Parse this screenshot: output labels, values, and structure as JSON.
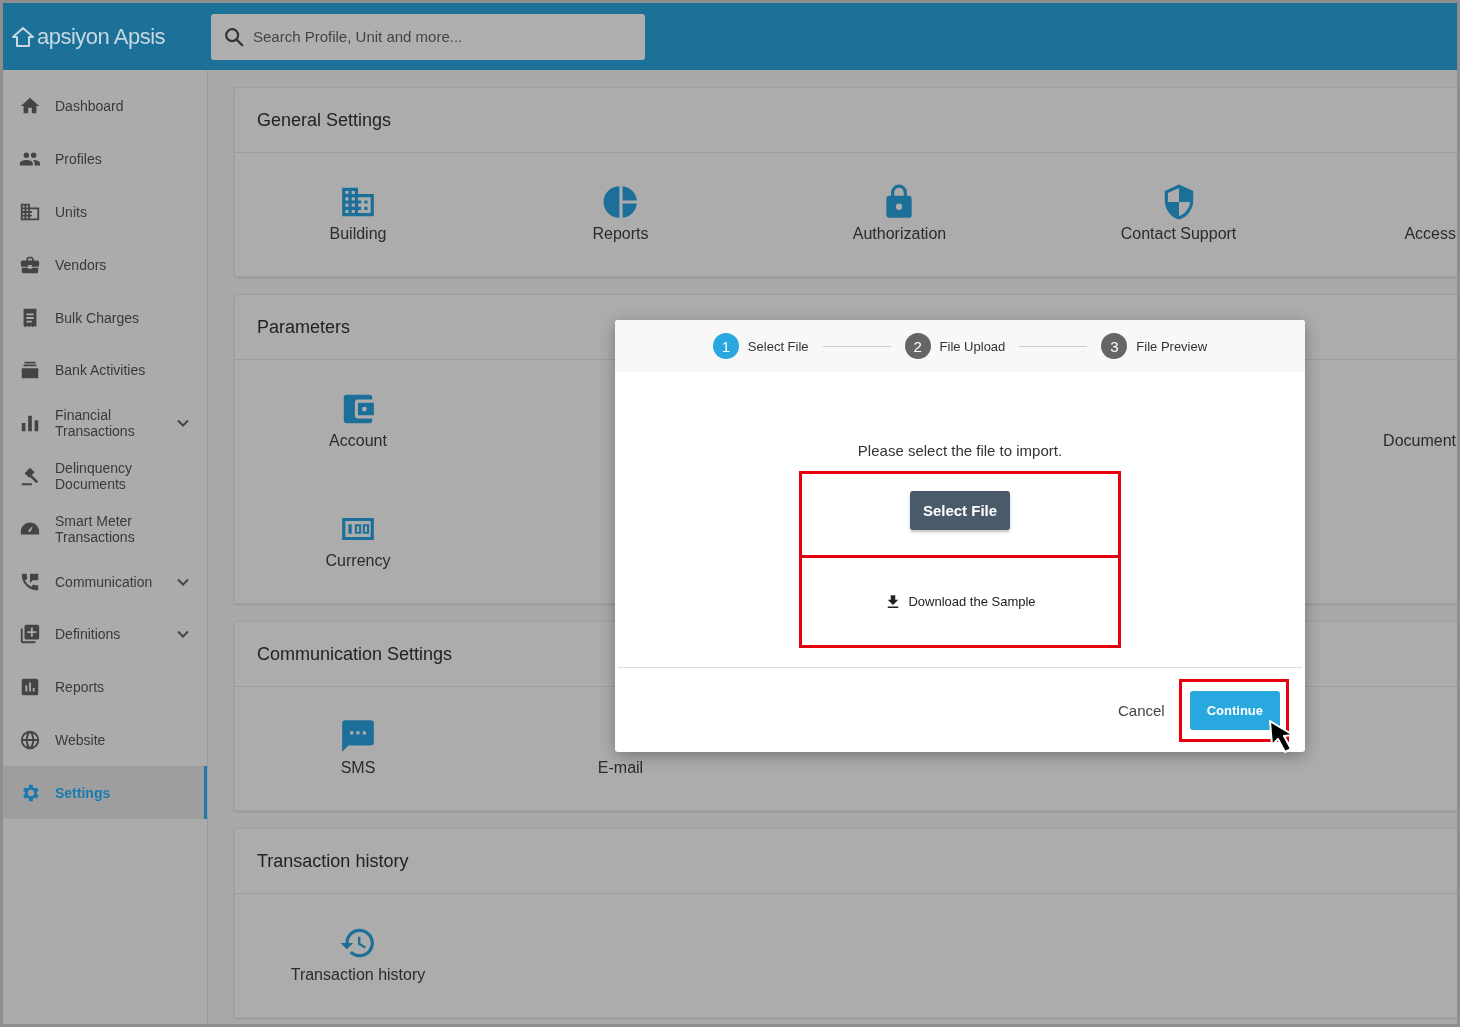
{
  "header": {
    "logo": "apsiyon Apsis",
    "search": {
      "placeholder": "Search Profile, Unit and more..."
    }
  },
  "sidebar": {
    "items": [
      {
        "label": "Dashboard",
        "selected": false,
        "has_submenu": false
      },
      {
        "label": "Profiles",
        "selected": false,
        "has_submenu": false
      },
      {
        "label": "Units",
        "selected": false,
        "has_submenu": false
      },
      {
        "label": "Vendors",
        "selected": false,
        "has_submenu": false
      },
      {
        "label": "Bulk Charges",
        "selected": false,
        "has_submenu": false
      },
      {
        "label": "Bank Activities",
        "selected": false,
        "has_submenu": false
      },
      {
        "label": "Financial Transactions",
        "selected": false,
        "has_submenu": true
      },
      {
        "label": "Delinquency Documents",
        "selected": false,
        "has_submenu": false
      },
      {
        "label": "Smart Meter Transactions",
        "selected": false,
        "has_submenu": false
      },
      {
        "label": "Communication",
        "selected": false,
        "has_submenu": true
      },
      {
        "label": "Definitions",
        "selected": false,
        "has_submenu": true
      },
      {
        "label": "Reports",
        "selected": false,
        "has_submenu": false
      },
      {
        "label": "Website",
        "selected": false,
        "has_submenu": false
      },
      {
        "label": "Settings",
        "selected": true,
        "has_submenu": false
      }
    ]
  },
  "sections": [
    {
      "title": "General Settings",
      "rows": [
        [
          {
            "label": "Building"
          },
          {
            "label": "Reports"
          },
          {
            "label": "Authorization"
          },
          {
            "label": "Contact Support"
          },
          {
            "label": "Access"
          }
        ]
      ]
    },
    {
      "title": "Parameters",
      "rows": [
        [
          {
            "label": "Account"
          },
          null,
          null,
          null,
          {
            "label": "Document"
          }
        ],
        [
          {
            "label": "Currency"
          }
        ]
      ]
    },
    {
      "title": "Communication Settings",
      "rows": [
        [
          {
            "label": "SMS"
          },
          {
            "label": "E-mail"
          }
        ]
      ]
    },
    {
      "title": "Transaction history",
      "rows": [
        [
          {
            "label": "Transaction history"
          }
        ]
      ]
    }
  ],
  "dialog": {
    "steps": [
      {
        "number": "1",
        "label": "Select File",
        "selected": true
      },
      {
        "number": "2",
        "label": "File Upload",
        "selected": false
      },
      {
        "number": "3",
        "label": "File Preview",
        "selected": false
      }
    ],
    "prompt": "Please select the file to import.",
    "select_button": "Select File",
    "download_link": "Download the Sample",
    "cancel": "Cancel",
    "continue": "Continue"
  }
}
